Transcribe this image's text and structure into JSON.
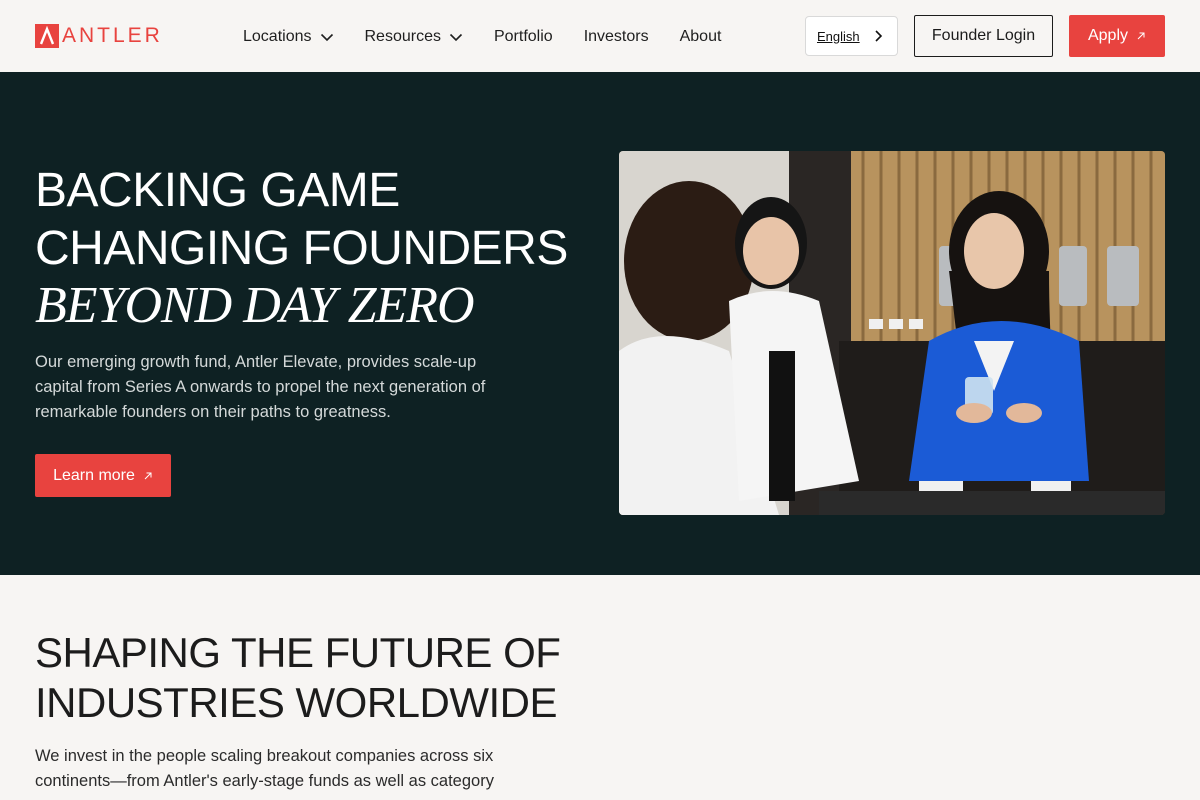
{
  "brand": {
    "name": "ANTLER",
    "accent_color": "#e8433f",
    "hero_bg": "#0e2123"
  },
  "nav": {
    "items": [
      {
        "label": "Locations",
        "has_dropdown": true
      },
      {
        "label": "Resources",
        "has_dropdown": true
      },
      {
        "label": "Portfolio",
        "has_dropdown": false
      },
      {
        "label": "Investors",
        "has_dropdown": false
      },
      {
        "label": "About",
        "has_dropdown": false
      }
    ]
  },
  "header": {
    "language": "English",
    "login_label": "Founder Login",
    "apply_label": "Apply"
  },
  "hero": {
    "title_line1": "BACKING GAME",
    "title_line2": "CHANGING FOUNDERS",
    "title_italic": "BEYOND DAY ZERO",
    "body": "Our emerging growth fund, Antler Elevate, provides scale-up capital from Series A onwards to propel the next generation of remarkable founders on their paths to greatness.",
    "cta_label": "Learn more",
    "image_icon": "photo-of-founders-talking"
  },
  "section": {
    "title_line1": "SHAPING THE FUTURE OF",
    "title_line2": "INDUSTRIES WORLDWIDE",
    "body": "We invest in the people scaling breakout companies across six continents—from Antler's early-stage funds as well as category"
  }
}
